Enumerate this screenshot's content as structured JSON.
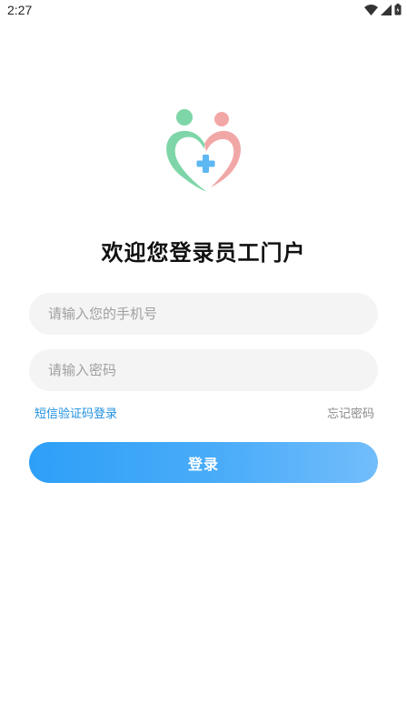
{
  "status_bar": {
    "time": "2:27",
    "icons": [
      "wifi-icon",
      "signal-icon",
      "battery-icon"
    ]
  },
  "logo": {
    "icon": "heart-medical-cross-logo",
    "colors": {
      "green": "#7ed6a8",
      "pink": "#f2a7a7",
      "cross": "#5db7f2"
    }
  },
  "welcome": {
    "title": "欢迎您登录员工门户"
  },
  "form": {
    "phone_placeholder": "请输入您的手机号",
    "password_placeholder": "请输入密码",
    "sms_login_link": "短信验证码登录",
    "forgot_password_link": "忘记密码",
    "login_button": "登录"
  },
  "colors": {
    "accent": "#2e9ff8",
    "link_blue": "#1f8fe0",
    "input_bg": "#f4f4f4"
  }
}
